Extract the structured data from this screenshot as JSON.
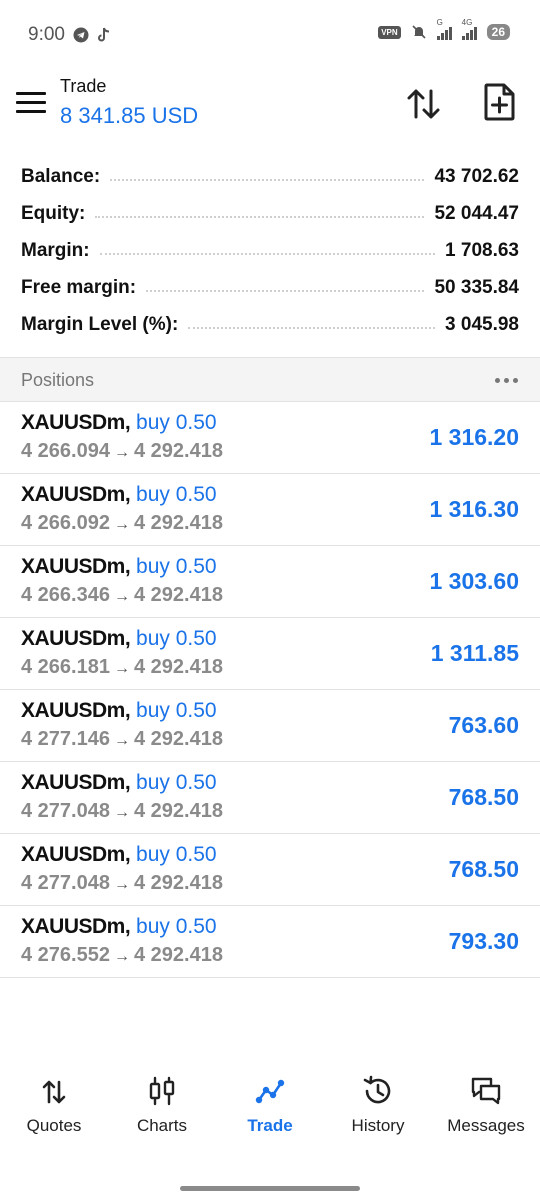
{
  "status": {
    "time": "9:00",
    "vpn": "VPN",
    "net1": "G",
    "net2": "4G",
    "battery": "26"
  },
  "header": {
    "title": "Trade",
    "balance_text": "8 341.85 USD"
  },
  "summary": [
    {
      "label": "Balance:",
      "value": "43 702.62"
    },
    {
      "label": "Equity:",
      "value": "52 044.47"
    },
    {
      "label": "Margin:",
      "value": "1 708.63"
    },
    {
      "label": "Free margin:",
      "value": "50 335.84"
    },
    {
      "label": "Margin Level (%):",
      "value": "3 045.98"
    }
  ],
  "positions": {
    "title": "Positions",
    "items": [
      {
        "symbol": "XAUUSDm,",
        "side": "buy 0.50",
        "open": "4 266.094",
        "current": "4 292.418",
        "profit": "1 316.20"
      },
      {
        "symbol": "XAUUSDm,",
        "side": "buy 0.50",
        "open": "4 266.092",
        "current": "4 292.418",
        "profit": "1 316.30"
      },
      {
        "symbol": "XAUUSDm,",
        "side": "buy 0.50",
        "open": "4 266.346",
        "current": "4 292.418",
        "profit": "1 303.60"
      },
      {
        "symbol": "XAUUSDm,",
        "side": "buy 0.50",
        "open": "4 266.181",
        "current": "4 292.418",
        "profit": "1 311.85"
      },
      {
        "symbol": "XAUUSDm,",
        "side": "buy 0.50",
        "open": "4 277.146",
        "current": "4 292.418",
        "profit": "763.60"
      },
      {
        "symbol": "XAUUSDm,",
        "side": "buy 0.50",
        "open": "4 277.048",
        "current": "4 292.418",
        "profit": "768.50"
      },
      {
        "symbol": "XAUUSDm,",
        "side": "buy 0.50",
        "open": "4 277.048",
        "current": "4 292.418",
        "profit": "768.50"
      },
      {
        "symbol": "XAUUSDm,",
        "side": "buy 0.50",
        "open": "4 276.552",
        "current": "4 292.418",
        "profit": "793.30"
      }
    ]
  },
  "nav": [
    {
      "label": "Quotes",
      "icon": "quotes-icon"
    },
    {
      "label": "Charts",
      "icon": "charts-icon"
    },
    {
      "label": "Trade",
      "icon": "trade-icon",
      "active": true
    },
    {
      "label": "History",
      "icon": "history-icon"
    },
    {
      "label": "Messages",
      "icon": "messages-icon"
    }
  ],
  "colors": {
    "accent": "#1a73e8",
    "muted": "#8a8a8a",
    "text": "#111111"
  }
}
